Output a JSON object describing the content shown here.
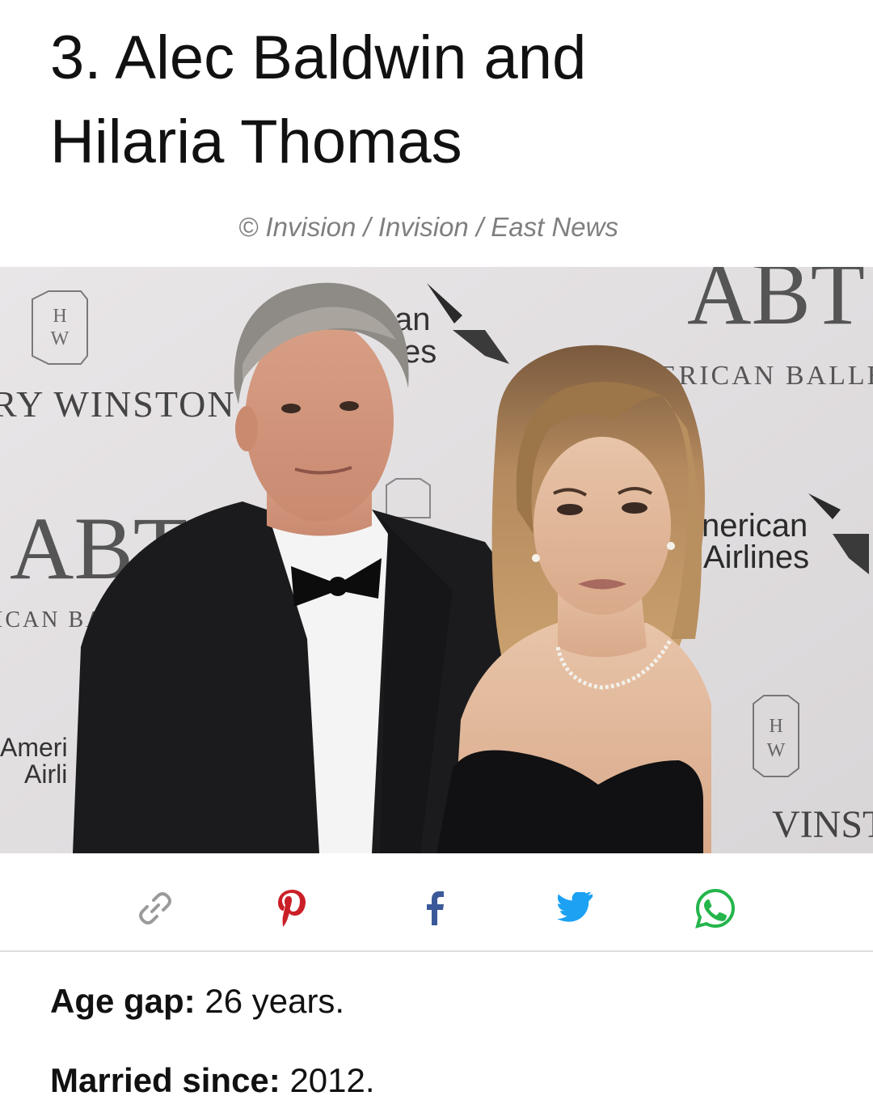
{
  "article": {
    "title_line1": "3. Alec Baldwin and",
    "title_line2": "Hilaria Thomas",
    "photo_credit": "© Invision / Invision / East News"
  },
  "photo": {
    "backdrop_texts": {
      "winston_left": "RY WINSTON",
      "abt_left": "ABT",
      "ballet_left": "ICAN BAL",
      "american_left_1": "Ameri",
      "american_left_2": "Airli",
      "an_top": "an",
      "es_top": "es",
      "abt_top": "ABT",
      "ballet_top": "AMERICAN BALLET T",
      "american_right_1": "nerican",
      "american_right_2": "Airlines",
      "winston_right": "VINST",
      "hw_h": "H",
      "hw_w": "W"
    }
  },
  "share": {
    "icons": [
      "link-icon",
      "pinterest-icon",
      "facebook-icon",
      "twitter-icon",
      "whatsapp-icon"
    ],
    "colors": {
      "link": "#9a9a9a",
      "pinterest": "#cb1f27",
      "facebook": "#3b5998",
      "twitter": "#1da1f2",
      "whatsapp": "#25b54b"
    }
  },
  "facts": {
    "age_gap_label": "Age gap:",
    "age_gap_value": "26 years.",
    "married_label": "Married since:",
    "married_value": "2012."
  }
}
